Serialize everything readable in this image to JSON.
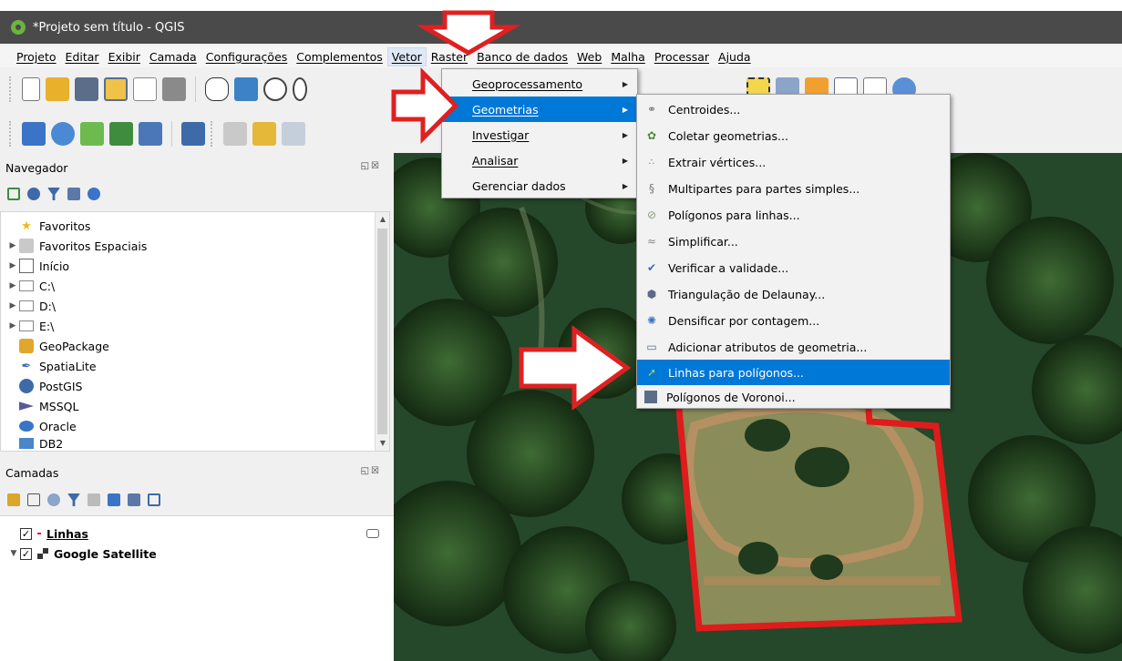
{
  "window": {
    "title": "*Projeto sem título - QGIS"
  },
  "menubar": {
    "items": [
      "Projeto",
      "Editar",
      "Exibir",
      "Camada",
      "Configurações",
      "Complementos",
      "Vetor",
      "Raster",
      "Banco de dados",
      "Web",
      "Malha",
      "Processar",
      "Ajuda"
    ],
    "active": "Vetor"
  },
  "navigator": {
    "title": "Navegador",
    "items": [
      "Favoritos",
      "Favoritos Espaciais",
      "Início",
      "C:\\",
      "D:\\",
      "E:\\",
      "GeoPackage",
      "SpatiaLite",
      "PostGIS",
      "MSSQL",
      "Oracle",
      "DB2"
    ]
  },
  "layers": {
    "title": "Camadas",
    "items": [
      {
        "name": "Linhas",
        "checked": true
      },
      {
        "name": "Google Satellite",
        "checked": true
      }
    ]
  },
  "vector_menu": {
    "items": [
      "Geoprocessamento",
      "Geometrias",
      "Investigar",
      "Analisar",
      "Gerenciar dados"
    ],
    "highlighted": "Geometrias"
  },
  "geometry_menu": {
    "items": [
      "Centroides...",
      "Coletar geometrias...",
      "Extrair vértices...",
      "Multipartes para partes simples...",
      "Polígonos para linhas...",
      "Simplificar...",
      "Verificar a validade...",
      "Triangulação de Delaunay...",
      "Densificar por contagem...",
      "Adicionar atributos de geometria...",
      "Linhas para polígonos...",
      "Polígonos de Voronoi..."
    ],
    "highlighted": "Linhas para polígonos..."
  },
  "colors": {
    "highlight": "#0078d7",
    "annotation_red": "#e02020",
    "boundary_red": "#e01b1b"
  }
}
